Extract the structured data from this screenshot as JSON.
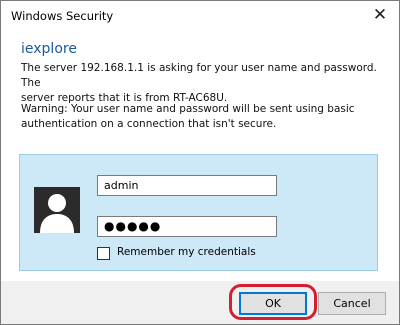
{
  "window": {
    "title": "Windows Security",
    "close_glyph": "✕",
    "close_icon": "close-icon"
  },
  "dialog": {
    "app_name": "iexplore",
    "message_lines": [
      "The server 192.168.1.1 is asking for your user name and password. The",
      "server reports that it is from RT-AC68U."
    ],
    "warning_lines": [
      "Warning: Your user name and password will be sent using basic",
      "authentication on a connection that isn't secure."
    ]
  },
  "credentials": {
    "avatar_icon": "user-silhouette-icon",
    "username_value": "admin",
    "password_value": "●●●●●",
    "remember_label": "Remember my credentials",
    "remember_checked": false
  },
  "buttons": {
    "ok_label": "OK",
    "cancel_label": "Cancel"
  },
  "colors": {
    "accent": "#0078d7",
    "panel_bg": "#cde8f6",
    "highlight": "#d41f33",
    "app_name": "#1c5a9c"
  }
}
